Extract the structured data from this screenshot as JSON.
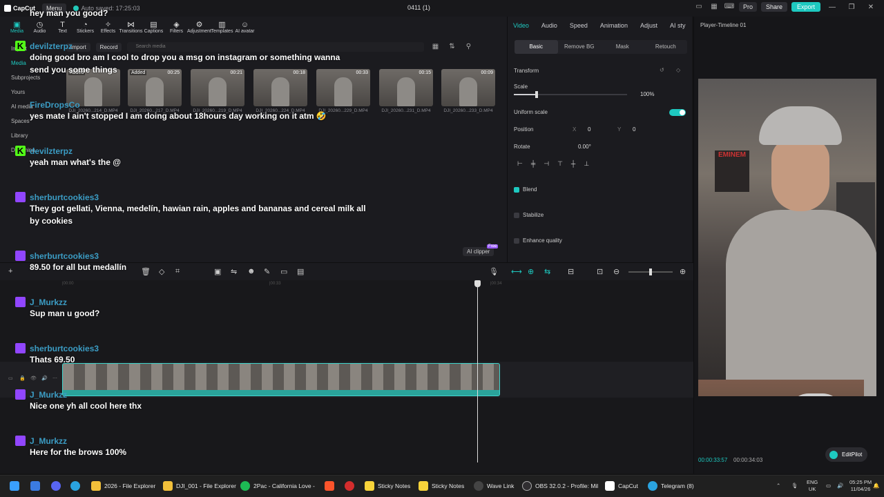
{
  "titlebar": {
    "app_name": "CapCut",
    "menu_label": "Menu",
    "autosave": "Auto saved: 17:25:03",
    "project_title": "0411 (1)",
    "pro_label": "Pro",
    "share_label": "Share",
    "export_label": "Export"
  },
  "toolbar": {
    "tools": [
      "Media",
      "Audio",
      "Text",
      "Stickers",
      "Effects",
      "Transitions",
      "Captions",
      "Filters",
      "Adjustment",
      "Templates",
      "AI avatar"
    ]
  },
  "media": {
    "nav": [
      "Import",
      "Media",
      "Subprojects",
      "Yours",
      "AI media",
      "Spaces",
      "Library",
      "Dreamina"
    ],
    "import_label": "Import",
    "record_label": "Record",
    "search_placeholder": "Search media",
    "clips": [
      {
        "name": "DJI_20260...214_D.MP4",
        "duration": "",
        "added": "Added"
      },
      {
        "name": "DJI_20260...217_D.MP4",
        "duration": "00:25",
        "added": "Added"
      },
      {
        "name": "DJI_20260...219_D.MP4",
        "duration": "00:21",
        "added": ""
      },
      {
        "name": "DJI_20260...224_D.MP4",
        "duration": "00:18",
        "added": ""
      },
      {
        "name": "DJI_20260...229_D.MP4",
        "duration": "00:33",
        "added": ""
      },
      {
        "name": "DJI_20260...231_D.MP4",
        "duration": "00:15",
        "added": ""
      },
      {
        "name": "DJI_20260...233_D.MP4",
        "duration": "00:09",
        "added": ""
      }
    ],
    "ai_clipper": "AI clipper",
    "free_tag": "Free"
  },
  "properties": {
    "tabs": [
      "Video",
      "Audio",
      "Speed",
      "Animation",
      "Adjust",
      "AI sty"
    ],
    "subtabs": [
      "Basic",
      "Remove BG",
      "Mask",
      "Retouch"
    ],
    "transform_label": "Transform",
    "scale_label": "Scale",
    "scale_value": "100%",
    "uniform_scale_label": "Uniform scale",
    "position_label": "Position",
    "pos_x_label": "X",
    "pos_x": "0",
    "pos_y_label": "Y",
    "pos_y": "0",
    "rotate_label": "Rotate",
    "rotate_value": "0.00°",
    "blend_label": "Blend",
    "stabilize_label": "Stabilize",
    "enhance_label": "Enhance quality"
  },
  "player": {
    "title": "Player-Timeline 01",
    "current_time": "00:00:33:57",
    "total_time": "00:00:34:03",
    "editpilot": "EditPilot",
    "poster_text": "EMINEM"
  },
  "timeline": {
    "ruler": [
      "|00:00",
      "|00:33",
      "|00:34"
    ]
  },
  "chat": [
    {
      "platform": "kick",
      "user": "",
      "text": "hey man you good?"
    },
    {
      "platform": "kick",
      "user": "devilzterpz",
      "text": "doing good bro am I cool to drop you a msg on instagram or something wanna send you some things"
    },
    {
      "platform": "none",
      "user": "FireDropsCo",
      "text": "yes mate I ain't stopped I am doing about 18hours day working on it atm 🤣"
    },
    {
      "platform": "kick",
      "user": "devilzterpz",
      "text": "yeah man what's the @"
    },
    {
      "platform": "twitch",
      "user": "sherburtcookies3",
      "text": "They got gellati, Vienna, medelín, hawian rain, apples and bananas and cereal milk all by cookies"
    },
    {
      "platform": "twitch",
      "user": "sherburtcookies3",
      "text": "89.50 for all but medallín"
    },
    {
      "platform": "twitch",
      "user": "J_Murkzz",
      "text": "Sup man u good?"
    },
    {
      "platform": "twitch",
      "user": "sherburtcookies3",
      "text": "Thats 69.50"
    },
    {
      "platform": "twitch",
      "user": "J_Murkzz",
      "text": "Nice one yh all cool here thx"
    },
    {
      "platform": "twitch",
      "user": "J_Murkzz",
      "text": "Here for the brows 100%"
    }
  ],
  "taskbar": {
    "items": [
      "2026 - File Explorer",
      "DJI_001 - File Explorer",
      "2Pac - California Love -",
      "Sticky Notes",
      "Sticky Notes",
      "Wave Link",
      "OBS 32.0.2 - Profile: Mil",
      "CapCut",
      "Telegram (8)"
    ],
    "lang": "ENG",
    "region": "UK",
    "time": "05:25 PM",
    "date": "11/04/26"
  }
}
